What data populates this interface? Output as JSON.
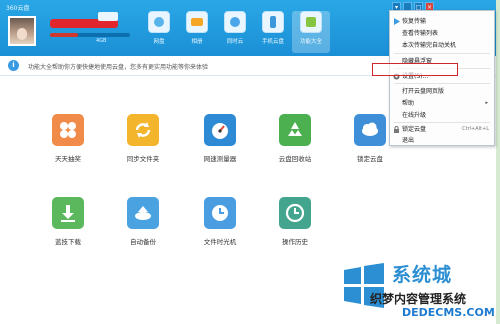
{
  "app": {
    "title": "360云盘"
  },
  "user": {
    "quota_text": "4GB",
    "quota_fraction": 0.35
  },
  "nav": [
    {
      "label": "网盘"
    },
    {
      "label": "相册"
    },
    {
      "label": "同时云"
    },
    {
      "label": "手机云盘"
    },
    {
      "label": "功能大全"
    }
  ],
  "window_controls": {
    "skin": "▾",
    "minimize": "_",
    "maximize": "□",
    "close": "×"
  },
  "banner": {
    "icon_text": "i",
    "text": "功能大全帮助你方便快捷地使用云盘，您多有更实用功能等你来体验"
  },
  "tiles": [
    {
      "label": "天天抽奖",
      "color": "#f08b4a"
    },
    {
      "label": "同步文件夹",
      "color": "#f3b52c"
    },
    {
      "label": "网速测量器",
      "color": "#2f8ad6"
    },
    {
      "label": "云盘回收站",
      "color": "#4caf50"
    },
    {
      "label": "锁定云盘",
      "color": "#3f8fd8"
    },
    {
      "label": "蓝技下载",
      "color": "#5cb85c"
    },
    {
      "label": "自动备份",
      "color": "#4aa3e0"
    },
    {
      "label": "文件时光机",
      "color": "#4a9de0"
    },
    {
      "label": "操作历史",
      "color": "#44a58f"
    }
  ],
  "menu": {
    "items": [
      {
        "label": "恢复传输"
      },
      {
        "label": "查看传输列表"
      },
      {
        "label": "本次传输完自动关机"
      },
      {
        "label": "隐藏悬浮窗"
      },
      {
        "label": "设置(S)..."
      },
      {
        "label": "打开云盘网页版"
      },
      {
        "label": "帮助",
        "arrow": "▸"
      },
      {
        "label": "在线升级"
      },
      {
        "label": "锁定云盘",
        "shortcut": "Ctrl+Alt+L"
      },
      {
        "label": "退出"
      }
    ]
  },
  "watermark": {
    "brand": "系统城",
    "sub": "织梦内容管理系统",
    "domain": "DEDECMS.COM"
  },
  "colors": {
    "header": "#1b8fd6",
    "highlight": "#d2242b"
  }
}
